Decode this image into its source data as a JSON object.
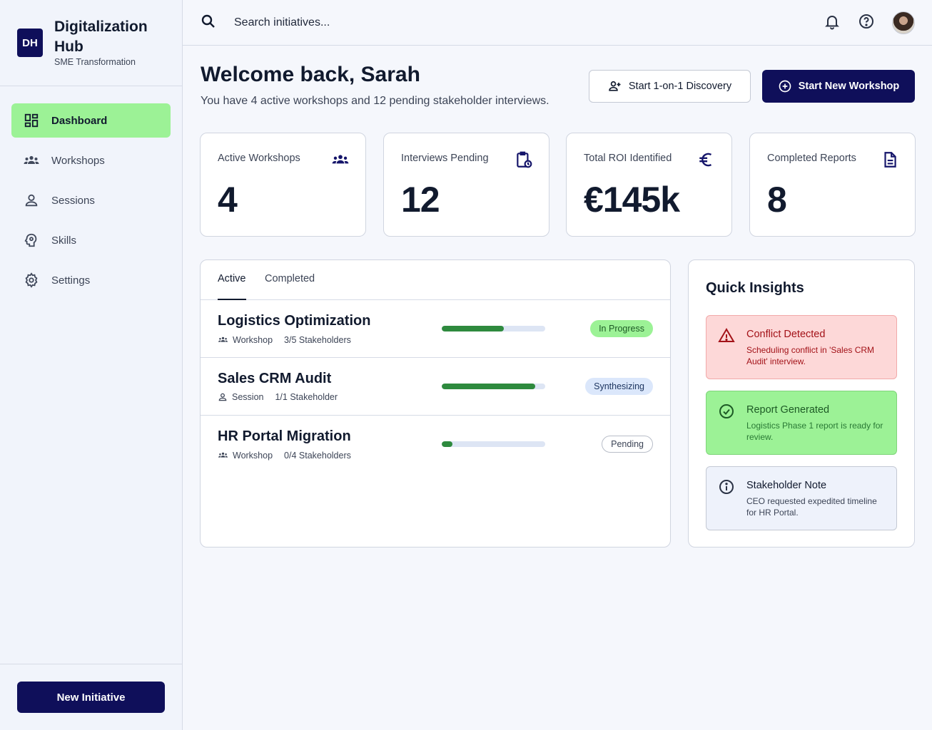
{
  "brand": {
    "logo": "DH",
    "title": "Digitalization Hub",
    "subtitle": "SME Transformation"
  },
  "sidebar": {
    "items": [
      {
        "label": "Dashboard",
        "icon": "dashboard-icon",
        "active": true
      },
      {
        "label": "Workshops",
        "icon": "group-icon",
        "active": false
      },
      {
        "label": "Sessions",
        "icon": "person-icon",
        "active": false
      },
      {
        "label": "Skills",
        "icon": "psychology-icon",
        "active": false
      },
      {
        "label": "Settings",
        "icon": "gear-icon",
        "active": false
      }
    ],
    "cta": "New Initiative"
  },
  "topbar": {
    "search_placeholder": "Search initiatives...",
    "icons": [
      "search-icon",
      "bell-icon",
      "help-icon",
      "avatar"
    ]
  },
  "welcome": {
    "title": "Welcome back, Sarah",
    "subtitle": "You have 4 active workshops and 12 pending stakeholder interviews.",
    "secondary_button": "Start 1-on-1 Discovery",
    "primary_button": "Start New Workshop"
  },
  "stats": [
    {
      "label": "Active Workshops",
      "value": "4",
      "icon": "group-icon"
    },
    {
      "label": "Interviews Pending",
      "value": "12",
      "icon": "pending-actions-icon"
    },
    {
      "label": "Total ROI Identified",
      "value": "€145k",
      "icon": "euro-icon"
    },
    {
      "label": "Completed Reports",
      "value": "8",
      "icon": "document-icon"
    }
  ],
  "initiatives": {
    "tabs": [
      "Active",
      "Completed"
    ],
    "active_tab": "Active",
    "rows": [
      {
        "title": "Logistics Optimization",
        "type": "Workshop",
        "type_icon": "group-icon",
        "stakeholders": "3/5 Stakeholders",
        "progress": 0.6,
        "status": "In Progress",
        "status_style": "green"
      },
      {
        "title": "Sales CRM Audit",
        "type": "Session",
        "type_icon": "person-icon",
        "stakeholders": "1/1 Stakeholder",
        "progress": 0.9,
        "status": "Synthesizing",
        "status_style": "blue"
      },
      {
        "title": "HR Portal Migration",
        "type": "Workshop",
        "type_icon": "group-icon",
        "stakeholders": "0/4 Stakeholders",
        "progress": 0.1,
        "status": "Pending",
        "status_style": "outline"
      }
    ]
  },
  "insights": {
    "title": "Quick Insights",
    "cards": [
      {
        "title": "Conflict Detected",
        "body": "Scheduling conflict in 'Sales CRM Audit' interview.",
        "icon": "warning-icon",
        "style": "red"
      },
      {
        "title": "Report Generated",
        "body": "Logistics Phase 1 report is ready for review.",
        "icon": "check-circle-icon",
        "style": "green"
      },
      {
        "title": "Stakeholder Note",
        "body": "CEO requested expedited timeline for HR Portal.",
        "icon": "info-icon",
        "style": "gray"
      }
    ]
  },
  "colors": {
    "primary": "#0f0f5a",
    "accent_green": "#9cf296",
    "progress_fill": "#2e8a3e",
    "alert_red": "#a31218"
  }
}
